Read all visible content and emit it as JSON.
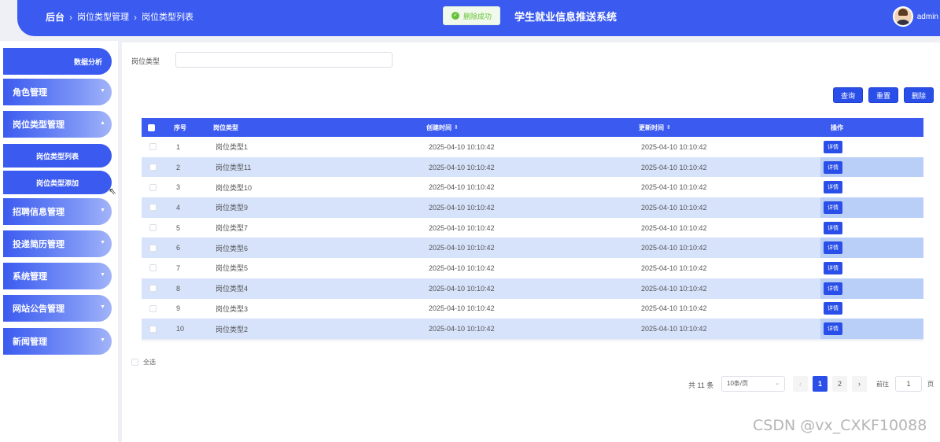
{
  "header": {
    "breadcrumb": [
      "后台",
      "岗位类型管理",
      "岗位类型列表"
    ],
    "system_title": "学生就业信息推送系统",
    "toast": "删除成功",
    "username": "admin"
  },
  "sidebar": {
    "items": [
      {
        "label": "数据分析"
      },
      {
        "label": "角色管理"
      },
      {
        "label": "岗位类型管理"
      },
      {
        "label": "岗位类型列表"
      },
      {
        "label": "岗位类型添加"
      },
      {
        "label": "招聘信息管理"
      },
      {
        "label": "投递简历管理"
      },
      {
        "label": "系统管理"
      },
      {
        "label": "网站公告管理"
      },
      {
        "label": "新闻管理"
      }
    ]
  },
  "search": {
    "label": "岗位类型",
    "value": "",
    "placeholder": ""
  },
  "toolbar": {
    "query": "查询",
    "reset": "重置",
    "delete": "删除"
  },
  "table": {
    "headers": {
      "index": "序号",
      "type": "岗位类型",
      "created": "创建时间",
      "updated": "更新时间",
      "op": "操作"
    },
    "rows": [
      {
        "index": "1",
        "type": "岗位类型1",
        "created": "2025-04-10 10:10:42",
        "updated": "2025-04-10 10:10:42",
        "op": "详情"
      },
      {
        "index": "2",
        "type": "岗位类型11",
        "created": "2025-04-10 10:10:42",
        "updated": "2025-04-10 10:10:42",
        "op": "详情"
      },
      {
        "index": "3",
        "type": "岗位类型10",
        "created": "2025-04-10 10:10:42",
        "updated": "2025-04-10 10:10:42",
        "op": "详情"
      },
      {
        "index": "4",
        "type": "岗位类型9",
        "created": "2025-04-10 10:10:42",
        "updated": "2025-04-10 10:10:42",
        "op": "详情"
      },
      {
        "index": "5",
        "type": "岗位类型7",
        "created": "2025-04-10 10:10:42",
        "updated": "2025-04-10 10:10:42",
        "op": "详情"
      },
      {
        "index": "6",
        "type": "岗位类型6",
        "created": "2025-04-10 10:10:42",
        "updated": "2025-04-10 10:10:42",
        "op": "详情"
      },
      {
        "index": "7",
        "type": "岗位类型5",
        "created": "2025-04-10 10:10:42",
        "updated": "2025-04-10 10:10:42",
        "op": "详情"
      },
      {
        "index": "8",
        "type": "岗位类型4",
        "created": "2025-04-10 10:10:42",
        "updated": "2025-04-10 10:10:42",
        "op": "详情"
      },
      {
        "index": "9",
        "type": "岗位类型3",
        "created": "2025-04-10 10:10:42",
        "updated": "2025-04-10 10:10:42",
        "op": "详情"
      },
      {
        "index": "10",
        "type": "岗位类型2",
        "created": "2025-04-10 10:10:42",
        "updated": "2025-04-10 10:10:42",
        "op": "详情"
      }
    ]
  },
  "select_all": "全选",
  "pagination": {
    "total": "共 11 条",
    "page_size": "10条/页",
    "pages": [
      "1",
      "2"
    ],
    "current": "1",
    "goto_label": "前往",
    "goto_value": "1",
    "page_unit": "页"
  },
  "watermark": "CSDN @vx_CXKF10088"
}
